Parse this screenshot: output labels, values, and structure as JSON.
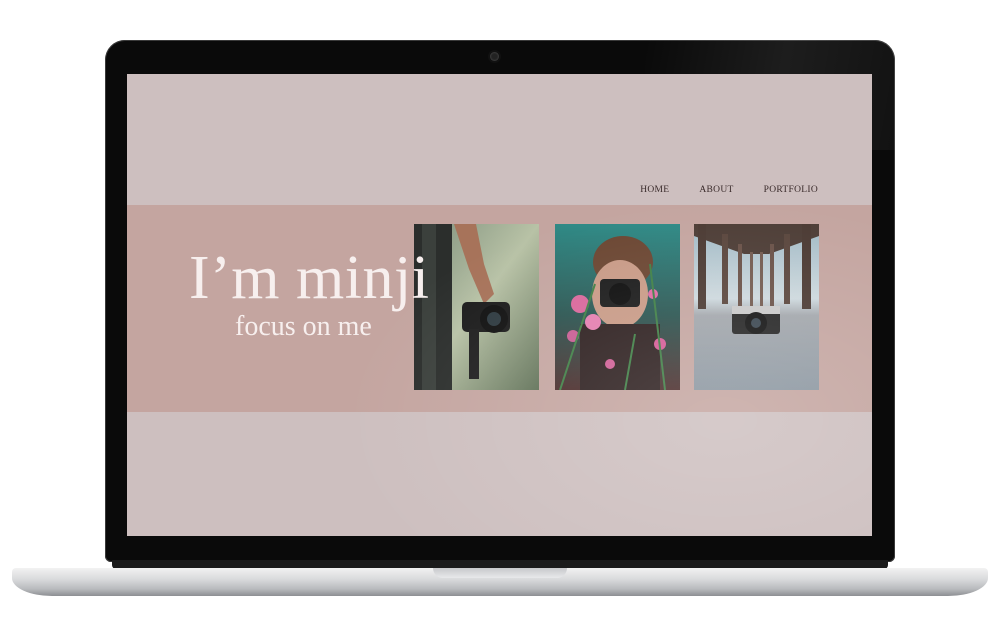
{
  "nav": {
    "home": "HOME",
    "about": "ABOUT",
    "portfolio": "PORTFOLIO"
  },
  "hero": {
    "headline": "I’m minji",
    "subline": "focus on me"
  },
  "photos": [
    {
      "subject": "hand holding camera"
    },
    {
      "subject": "photographer behind flowers"
    },
    {
      "subject": "camera on sand under pier"
    }
  ],
  "colors": {
    "screen_background": "#cdbfbf",
    "band": "#c4a5a0",
    "headline_text": "#f7efee",
    "nav_text": "#3a2b2b"
  }
}
